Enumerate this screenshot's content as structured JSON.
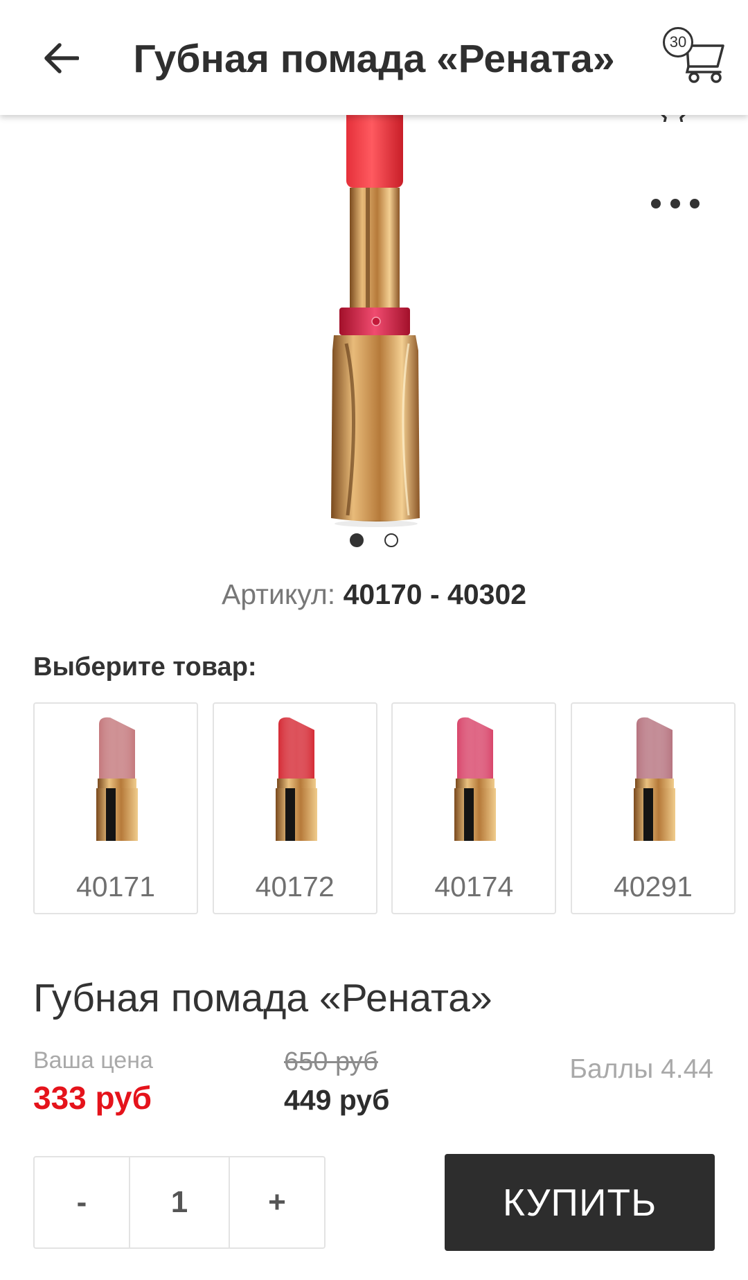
{
  "header": {
    "title": "Губная помада «Рената»",
    "cart_count": "30",
    "back_icon": "arrow-left-icon",
    "cart_icon": "shopping-cart-icon"
  },
  "gallery": {
    "image_count": 2,
    "active_index": 0,
    "favorite_icon": "star-icon",
    "more_icon": "more-horizontal-icon"
  },
  "sku": {
    "label": "Артикул:",
    "value": "40170 - 40302"
  },
  "variants": {
    "heading": "Выберите товар:",
    "items": [
      {
        "code": "40171",
        "color": "#c4787c"
      },
      {
        "code": "40172",
        "color": "#d52a35"
      },
      {
        "code": "40174",
        "color": "#d8456a"
      },
      {
        "code": "40291",
        "color": "#b6737f"
      }
    ]
  },
  "product": {
    "name": "Губная помада «Рената»",
    "your_price_label": "Ваша цена",
    "your_price": "333 руб",
    "old_price": "650 руб",
    "price": "449 руб",
    "points": "Баллы 4.44"
  },
  "cart_controls": {
    "minus": "-",
    "quantity": "1",
    "plus": "+",
    "buy": "КУПИТЬ"
  },
  "colors": {
    "accent_red": "#e5131b",
    "dark_button": "#2d2d2d"
  }
}
